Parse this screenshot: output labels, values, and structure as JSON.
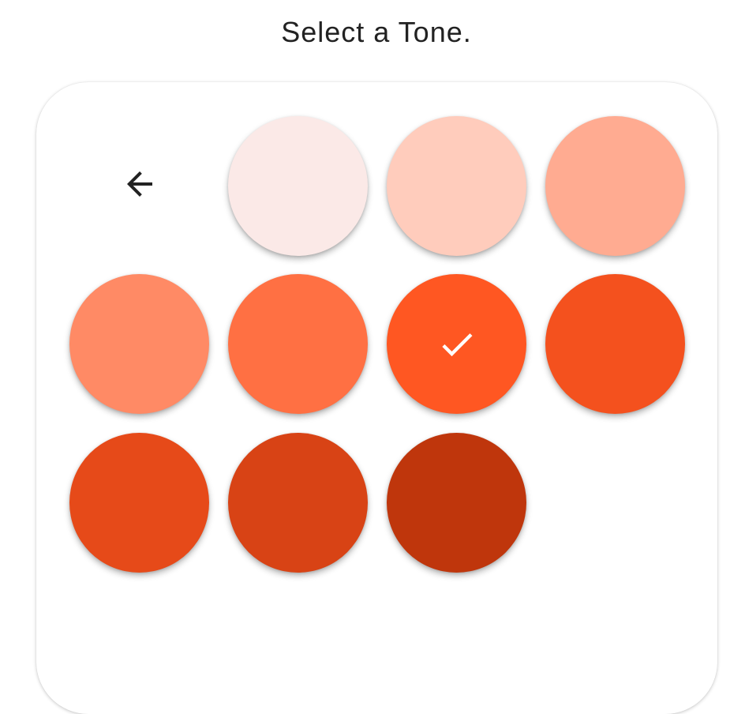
{
  "header": {
    "title": "Select a Tone."
  },
  "icons": {
    "back": "arrow-back-icon",
    "selected": "check-icon"
  },
  "tones": [
    {
      "color": "#fbe9e7",
      "selected": false
    },
    {
      "color": "#ffccbc",
      "selected": false
    },
    {
      "color": "#ffab91",
      "selected": false
    },
    {
      "color": "#ff8a65",
      "selected": false
    },
    {
      "color": "#ff7043",
      "selected": false
    },
    {
      "color": "#ff5722",
      "selected": true
    },
    {
      "color": "#f4511e",
      "selected": false
    },
    {
      "color": "#e64a19",
      "selected": false
    },
    {
      "color": "#d84315",
      "selected": false
    },
    {
      "color": "#bf360c",
      "selected": false
    }
  ]
}
